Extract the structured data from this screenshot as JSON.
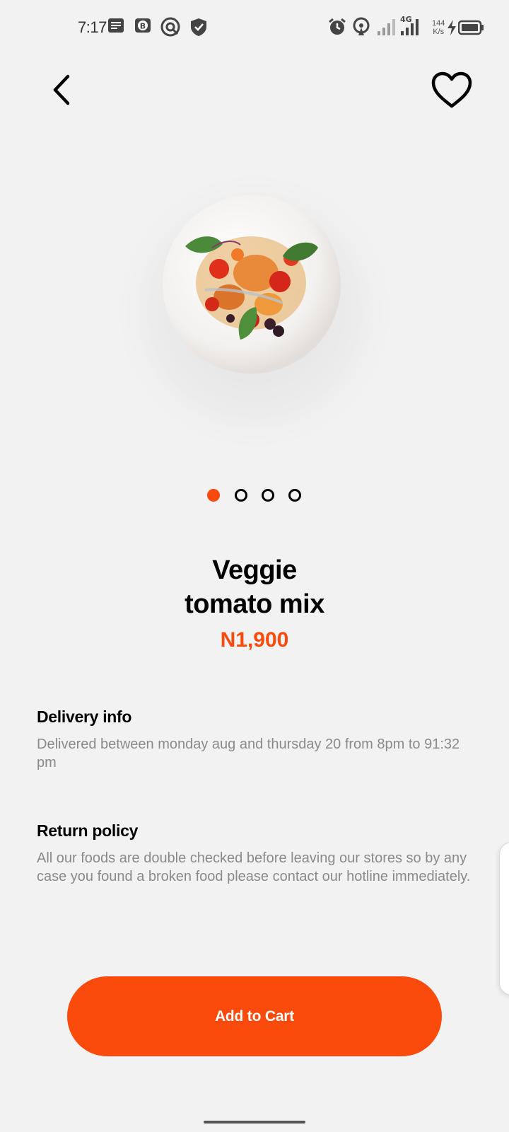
{
  "status_bar": {
    "time": "7:17",
    "network_speed_value": "144",
    "network_speed_unit": "K/s",
    "network_type": "4G",
    "icons": [
      "notes-icon",
      "b-app-icon",
      "vpn-icon",
      "shield-icon",
      "alarm-icon",
      "hotspot-icon",
      "signal-icon",
      "signal-4g-icon",
      "charging-icon",
      "battery-icon"
    ]
  },
  "header": {
    "back_icon": "chevron-left-icon",
    "favorite_icon": "heart-outline-icon"
  },
  "product": {
    "title_line1": "Veggie",
    "title_line2": "tomato mix",
    "price": "N1,900",
    "image_slides": 4,
    "active_slide": 1
  },
  "delivery": {
    "heading": "Delivery info",
    "body": "Delivered between monday aug and thursday 20 from 8pm to 91:32 pm"
  },
  "return_policy": {
    "heading": "Return policy",
    "body": "All our foods are double checked before leaving our stores so by any case you found a broken food please contact our hotline immediately."
  },
  "cta": {
    "label": "Add to Cart"
  },
  "colors": {
    "accent": "#fa4a0c",
    "background": "#f2f2f2",
    "text_primary": "#000000",
    "text_secondary": "#8a8a8a"
  }
}
